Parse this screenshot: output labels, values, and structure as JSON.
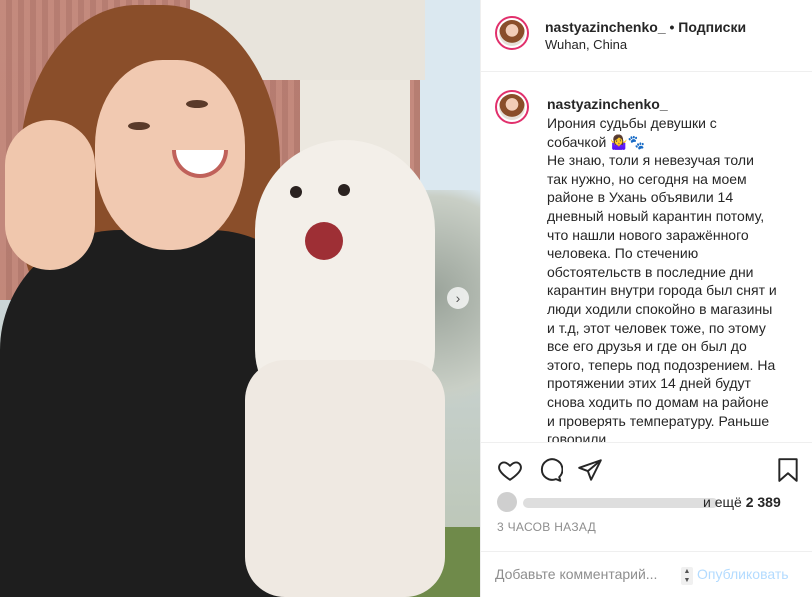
{
  "header": {
    "username": "nastyazinchenko_",
    "dot": "•",
    "follow_label": "Подписки",
    "location": "Wuhan, China"
  },
  "caption": {
    "username": "nastyazinchenko_",
    "text": "Ирония судьбы девушки с собачкой 🤷‍♀️🐾\nНе знаю, толи я невезучая толи так нужно, но сегодня на моем районе в Ухань объявили 14 дневный новый карантин потому, что нашли нового заражённого человека. По стечению обстоятельств в последние дни карантин внутри города был снят и люди ходили спокойно в магазины и т.д, этот человек тоже, по этому все его друзья и где он был до этого, теперь под подозрением. На протяжении этих 14 дней будут снова ходить по домам на районе и проверять температуру. Раньше говорили"
  },
  "actions": {
    "icons": [
      "heart-icon",
      "comment-icon",
      "share-icon",
      "bookmark-icon"
    ]
  },
  "likes": {
    "and_more": "и ещё",
    "count": "2 389"
  },
  "timestamp": "3 ЧАСОВ НАЗАД",
  "comment": {
    "placeholder": "Добавьте комментарий...",
    "publish_label": "Опубликовать"
  },
  "photo": {
    "next_arrow": "›"
  },
  "colors": {
    "link_disabled": "#b3dbff",
    "muted": "#8e8e8e",
    "text": "#262626",
    "story_ring": "#e1306c"
  }
}
